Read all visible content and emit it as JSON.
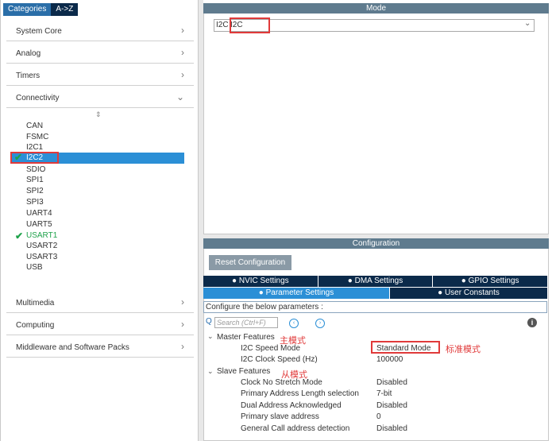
{
  "tabs": {
    "categories": "Categories",
    "az": "A->Z"
  },
  "categories": [
    {
      "label": "System Core",
      "chevron": "›"
    },
    {
      "label": "Analog",
      "chevron": "›"
    },
    {
      "label": "Timers",
      "chevron": "›"
    },
    {
      "label": "Connectivity",
      "chevron": "⌄"
    }
  ],
  "sort_glyph": "⇕",
  "connectivity_items": [
    "CAN",
    "FSMC",
    "I2C1",
    "I2C2",
    "SDIO",
    "SPI1",
    "SPI2",
    "SPI3",
    "UART4",
    "UART5",
    "USART1",
    "USART2",
    "USART3",
    "USB"
  ],
  "bottom_categories": [
    {
      "label": "Multimedia",
      "chevron": "›"
    },
    {
      "label": "Computing",
      "chevron": "›"
    },
    {
      "label": "Middleware and Software Packs",
      "chevron": "›"
    }
  ],
  "check_glyph": "✔",
  "mode": {
    "header": "Mode",
    "label": "I2C",
    "value": "I2C",
    "dropdown_glyph": "⌄"
  },
  "configuration": {
    "header": "Configuration",
    "reset_button": "Reset Configuration",
    "tabs_row1": [
      "NVIC Settings",
      "DMA Settings",
      "GPIO Settings"
    ],
    "tabs_row2": [
      "Parameter Settings",
      "User Constants"
    ],
    "tab_glyph": "●",
    "configure_text": "Configure the below parameters :",
    "search_placeholder": "Search (Ctrl+F)",
    "search_icon": "Q",
    "prev_icon": "‹",
    "next_icon": "›",
    "info_icon": "i"
  },
  "params": {
    "master_group": "Master Features",
    "master_note": "主模式",
    "expand_glyph": "⌄",
    "speed_mode_label": "I2C Speed Mode",
    "speed_mode_value": "Standard Mode",
    "speed_mode_note": "标准模式",
    "clock_speed_label": "I2C Clock Speed (Hz)",
    "clock_speed_value": "100000",
    "slave_group": "Slave Features",
    "slave_note": "从模式",
    "slave_rows": [
      {
        "label": "Clock No Stretch Mode",
        "value": "Disabled"
      },
      {
        "label": "Primary Address Length selection",
        "value": "7-bit"
      },
      {
        "label": "Dual Address Acknowledged",
        "value": "Disabled"
      },
      {
        "label": "Primary slave address",
        "value": "0"
      },
      {
        "label": "General Call address detection",
        "value": "Disabled"
      }
    ]
  },
  "colors": {
    "accent": "#2b8fd6",
    "dark_tab": "#0b2a4a",
    "header": "#5f7b8e",
    "check": "#1fa24b",
    "annotation": "#e03a3a"
  }
}
